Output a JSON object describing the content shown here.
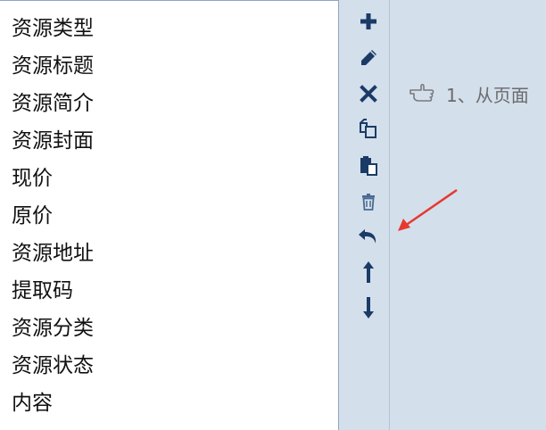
{
  "field_list": {
    "items": [
      {
        "label": "资源类型"
      },
      {
        "label": "资源标题"
      },
      {
        "label": "资源简介"
      },
      {
        "label": "资源封面"
      },
      {
        "label": "现价"
      },
      {
        "label": "原价"
      },
      {
        "label": "资源地址"
      },
      {
        "label": "提取码"
      },
      {
        "label": "资源分类"
      },
      {
        "label": "资源状态"
      },
      {
        "label": "内容"
      }
    ]
  },
  "toolbar": {
    "icons": [
      "plus-icon",
      "pencil-icon",
      "close-icon",
      "copy-icon",
      "paste-icon",
      "trash-icon",
      "undo-icon",
      "arrow-up-icon",
      "arrow-down-icon"
    ]
  },
  "hint": {
    "text": "1、从页面",
    "icon": "hand-pointer-icon"
  },
  "colors": {
    "background": "#d4dfec",
    "list_background": "#ffffff",
    "icon": "#1a3b66",
    "annotation_arrow": "#e53a2f",
    "hint_text": "#6b6b6b"
  }
}
